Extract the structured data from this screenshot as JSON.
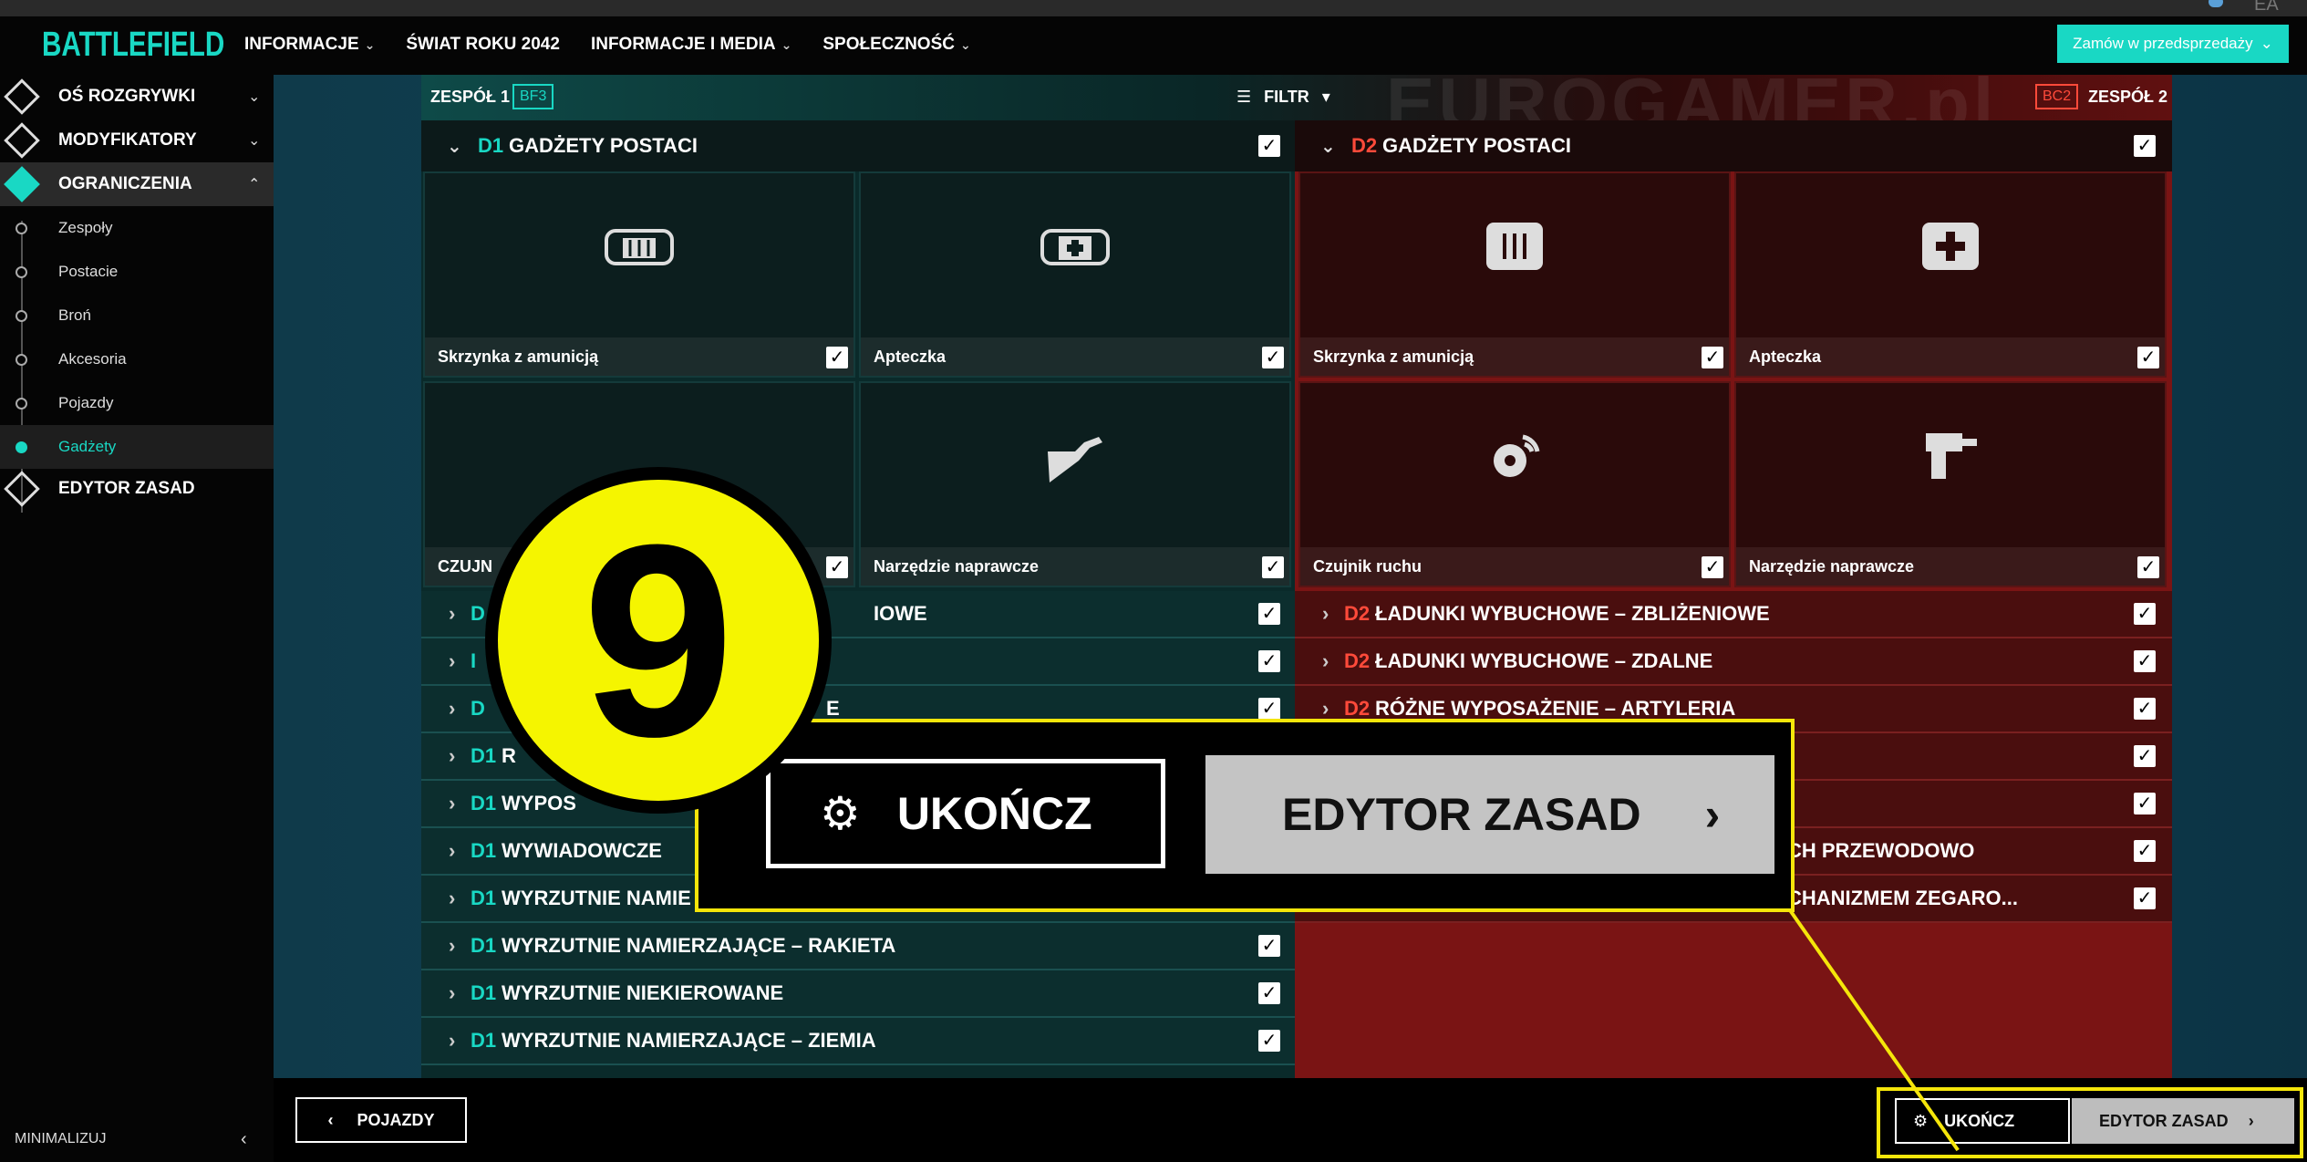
{
  "brand": {
    "logo": "BATTLEFIELD",
    "accent": "#19d8c4",
    "team1_color": "#19d8c4",
    "team2_color": "#ff4a3a",
    "highlight": "#f5e60a"
  },
  "nav": {
    "items": [
      {
        "label": "INFORMACJE"
      },
      {
        "label": "ŚWIAT ROKU 2042"
      },
      {
        "label": "INFORMACJE I MEDIA"
      },
      {
        "label": "SPOŁECZNOŚĆ"
      }
    ],
    "preorder": "Zamów w przedsprzedaży",
    "top_right": "EA"
  },
  "sidebar": {
    "main": [
      {
        "label": "OŚ ROZGRYWKI"
      },
      {
        "label": "MODYFIKATORY"
      },
      {
        "label": "OGRANICZENIA"
      },
      {
        "label": "EDYTOR ZASAD"
      }
    ],
    "sub": [
      {
        "label": "Zespoły"
      },
      {
        "label": "Postacie"
      },
      {
        "label": "Broń"
      },
      {
        "label": "Akcesoria"
      },
      {
        "label": "Pojazdy"
      },
      {
        "label": "Gadżety"
      }
    ],
    "minimize": "MINIMALIZUJ"
  },
  "teams": {
    "team1": "ZESPÓŁ 1",
    "team1_tag": "BF3",
    "team2": "ZESPÓŁ 2",
    "team2_tag": "BC2",
    "filter": "FILTR",
    "watermark": "EUROGAMER.pl"
  },
  "left": {
    "head_code": "D1",
    "head_title": "GADŻETY POSTACI",
    "tiles": [
      "Skrzynka z amunicją",
      "Apteczka",
      "CZUJN",
      "Narzędzie naprawcze"
    ],
    "rows": [
      {
        "code": "D",
        "text": "IOWE"
      },
      {
        "code": "I",
        "text": ""
      },
      {
        "code": "D",
        "text": "E"
      },
      {
        "code": "D1",
        "text": "R"
      },
      {
        "code": "D1",
        "text": "WYPOS"
      },
      {
        "code": "D1",
        "text": "WYWIADOWCZE"
      },
      {
        "code": "D1",
        "text": "WYRZUTNIE NAMIE"
      },
      {
        "code": "D1",
        "text": "WYRZUTNIE NAMIERZAJĄCE – RAKIETA"
      },
      {
        "code": "D1",
        "text": "WYRZUTNIE NIEKIEROWANE"
      },
      {
        "code": "D1",
        "text": "WYRZUTNIE NAMIERZAJĄCE – ZIEMIA"
      }
    ]
  },
  "right": {
    "head_code": "D2",
    "head_title": "GADŻETY POSTACI",
    "tiles": [
      "Skrzynka z amunicją",
      "Apteczka",
      "Czujnik ruchu",
      "Narzędzie naprawcze"
    ],
    "rows": [
      {
        "code": "D2",
        "text": "ŁADUNKI WYBUCHOWE – ZBLIŻENIOWE"
      },
      {
        "code": "D2",
        "text": "ŁADUNKI WYBUCHOWE – ZDALNE"
      },
      {
        "code": "D2",
        "text": "RÓŻNE WYPOSAŻENIE – ARTYLERIA"
      },
      {
        "code": "",
        "text": ""
      },
      {
        "code": "",
        "text": ""
      },
      {
        "code": "",
        "text": "CH PRZEWODOWO"
      },
      {
        "code": "",
        "text": "CHANIZMEM ZEGARO..."
      }
    ]
  },
  "bottom": {
    "back": "POJAZDY",
    "finish": "UKOŃCZ",
    "editor": "EDYTOR ZASAD"
  },
  "overlay": {
    "number": "9",
    "finish": "UKOŃCZ",
    "editor": "EDYTOR ZASAD"
  }
}
